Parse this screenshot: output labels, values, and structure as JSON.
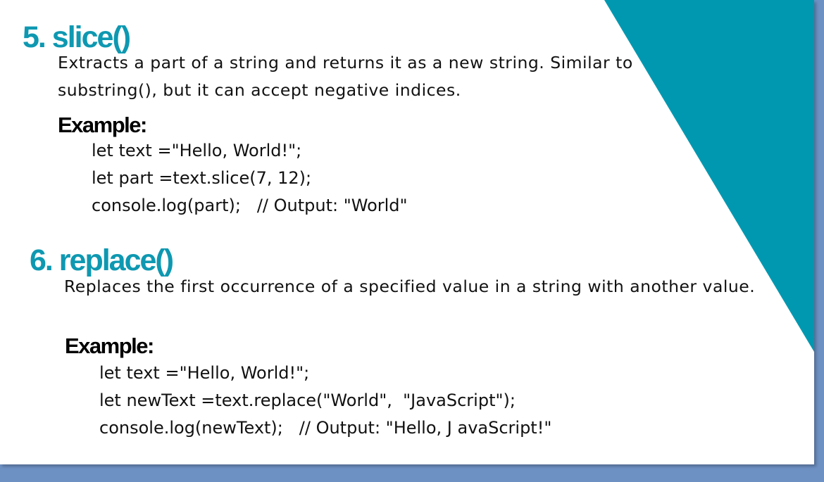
{
  "theme": {
    "accent": "#0e98b1",
    "background": "#ffffff",
    "frame": "#6e91c4"
  },
  "sections": [
    {
      "heading": "5. slice()",
      "description": "Extracts a part of a string and returns it as a new string. Similar to substring(), but it can accept negative indices.",
      "example_label": "Example:",
      "code": [
        "let text =\"Hello, World!\";",
        "let part =text.slice(7, 12);",
        "console.log(part);   // Output: \"World\""
      ]
    },
    {
      "heading": "6. replace()",
      "description": "Replaces the first occurrence of a specified value in a string with another value.",
      "example_label": "Example:",
      "code": [
        "let text =\"Hello, World!\";",
        "let newText =text.replace(\"World\",  \"JavaScript\");",
        "console.log(newText);   // Output: \"Hello, J avaScript!\""
      ]
    }
  ]
}
